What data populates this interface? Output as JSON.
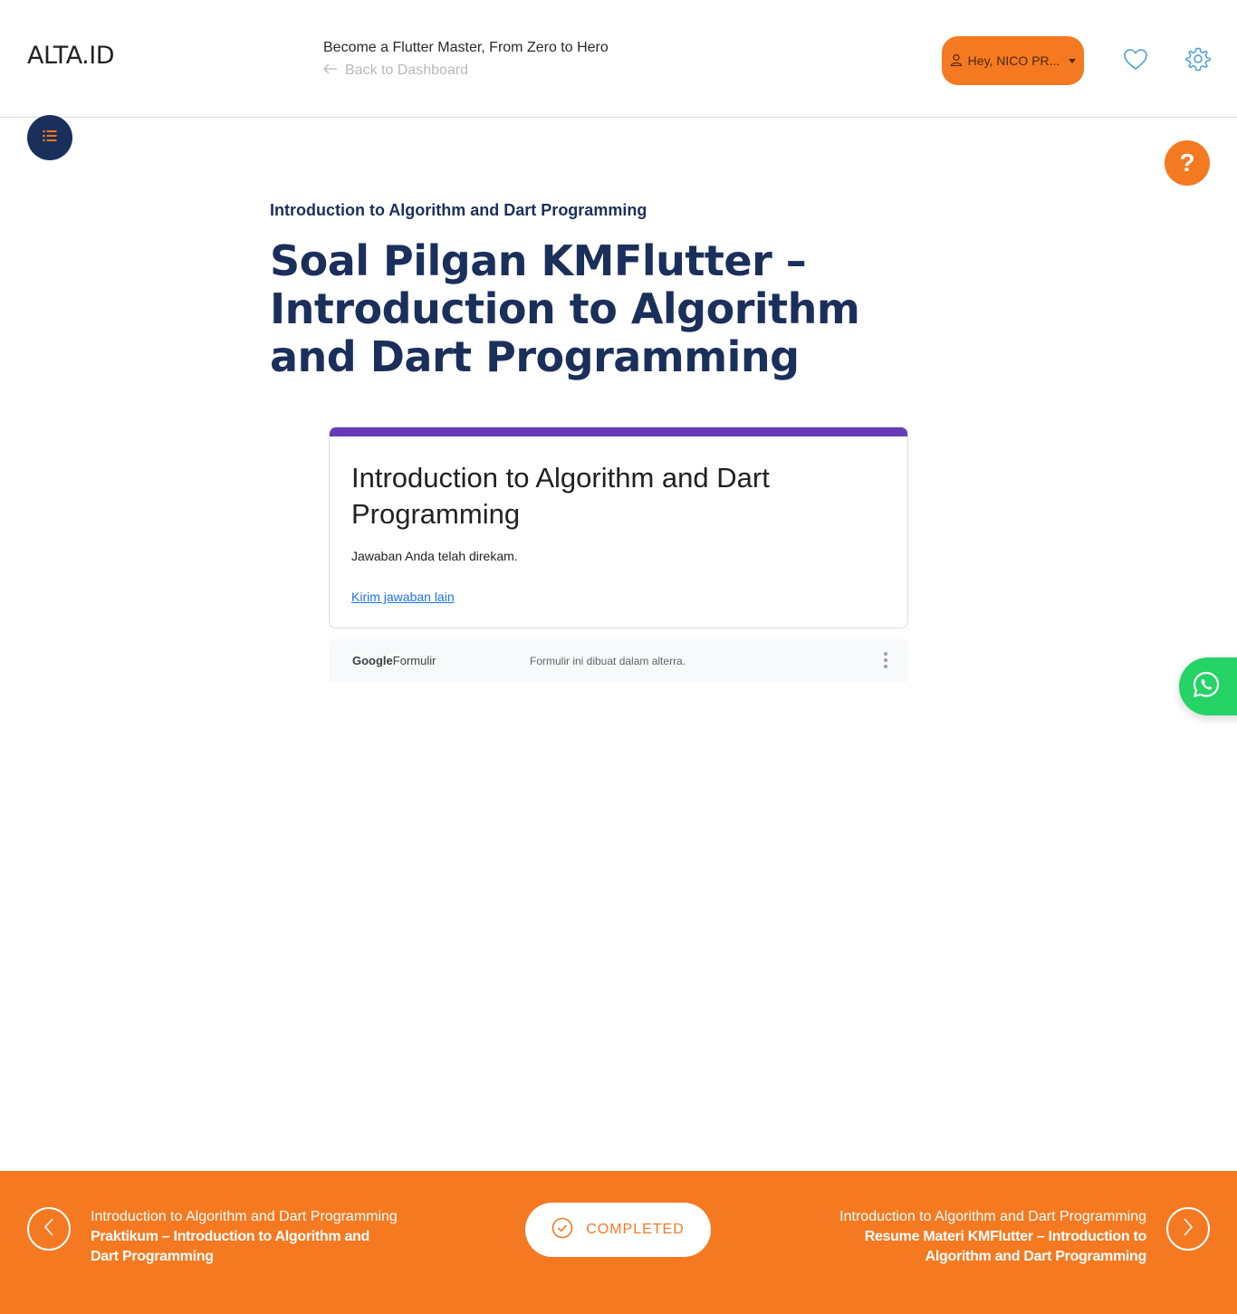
{
  "header": {
    "logo": "ALTA.ID",
    "course_title": "Become a Flutter Master, From Zero to Hero",
    "back_link": "Back to Dashboard",
    "user_greeting": "Hey, NICO PR..."
  },
  "content": {
    "section_label": "Introduction to Algorithm and Dart Programming",
    "page_title": "Soal Pilgan KMFlutter – Introduction to Algorithm and Dart Programming"
  },
  "form": {
    "accent_color": "#673ab7",
    "title": "Introduction to Algorithm and Dart Programming",
    "message": "Jawaban Anda telah direkam.",
    "resubmit_link": "Kirim jawaban lain",
    "footer_brand_google": "Google",
    "footer_brand_product": "Formulir",
    "footer_note": "Formulir ini dibuat dalam alterra."
  },
  "bottom_nav": {
    "prev_section": "Introduction to Algorithm and Dart Programming",
    "prev_title": "Praktikum – Introduction to Algorithm and Dart Programming",
    "status_label": "COMPLETED",
    "next_section": "Introduction to Algorithm and Dart Programming",
    "next_title": "Resume Materi KMFlutter – Introduction to Algorithm and Dart Programming"
  },
  "colors": {
    "brand_orange": "#f47920",
    "brand_navy": "#1b2f5b",
    "whatsapp_green": "#25d366"
  },
  "icons": [
    "user-icon",
    "caret-down-icon",
    "heart-icon",
    "gear-icon",
    "list-icon",
    "question-icon",
    "whatsapp-icon",
    "arrow-left-icon",
    "chevron-left-icon",
    "chevron-right-icon",
    "check-circle-icon",
    "more-vertical-icon"
  ]
}
